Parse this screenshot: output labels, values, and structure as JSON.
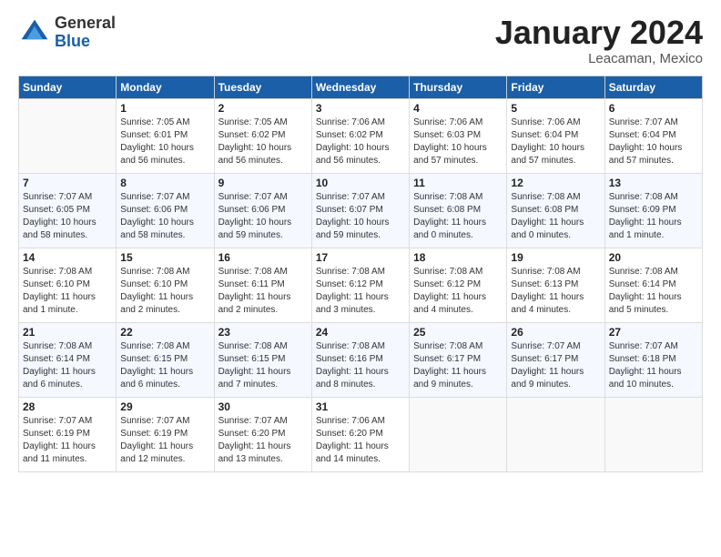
{
  "header": {
    "logo_general": "General",
    "logo_blue": "Blue",
    "month_title": "January 2024",
    "location": "Leacaman, Mexico"
  },
  "weekdays": [
    "Sunday",
    "Monday",
    "Tuesday",
    "Wednesday",
    "Thursday",
    "Friday",
    "Saturday"
  ],
  "weeks": [
    [
      {
        "day": "",
        "info": ""
      },
      {
        "day": "1",
        "info": "Sunrise: 7:05 AM\nSunset: 6:01 PM\nDaylight: 10 hours\nand 56 minutes."
      },
      {
        "day": "2",
        "info": "Sunrise: 7:05 AM\nSunset: 6:02 PM\nDaylight: 10 hours\nand 56 minutes."
      },
      {
        "day": "3",
        "info": "Sunrise: 7:06 AM\nSunset: 6:02 PM\nDaylight: 10 hours\nand 56 minutes."
      },
      {
        "day": "4",
        "info": "Sunrise: 7:06 AM\nSunset: 6:03 PM\nDaylight: 10 hours\nand 57 minutes."
      },
      {
        "day": "5",
        "info": "Sunrise: 7:06 AM\nSunset: 6:04 PM\nDaylight: 10 hours\nand 57 minutes."
      },
      {
        "day": "6",
        "info": "Sunrise: 7:07 AM\nSunset: 6:04 PM\nDaylight: 10 hours\nand 57 minutes."
      }
    ],
    [
      {
        "day": "7",
        "info": "Sunrise: 7:07 AM\nSunset: 6:05 PM\nDaylight: 10 hours\nand 58 minutes."
      },
      {
        "day": "8",
        "info": "Sunrise: 7:07 AM\nSunset: 6:06 PM\nDaylight: 10 hours\nand 58 minutes."
      },
      {
        "day": "9",
        "info": "Sunrise: 7:07 AM\nSunset: 6:06 PM\nDaylight: 10 hours\nand 59 minutes."
      },
      {
        "day": "10",
        "info": "Sunrise: 7:07 AM\nSunset: 6:07 PM\nDaylight: 10 hours\nand 59 minutes."
      },
      {
        "day": "11",
        "info": "Sunrise: 7:08 AM\nSunset: 6:08 PM\nDaylight: 11 hours\nand 0 minutes."
      },
      {
        "day": "12",
        "info": "Sunrise: 7:08 AM\nSunset: 6:08 PM\nDaylight: 11 hours\nand 0 minutes."
      },
      {
        "day": "13",
        "info": "Sunrise: 7:08 AM\nSunset: 6:09 PM\nDaylight: 11 hours\nand 1 minute."
      }
    ],
    [
      {
        "day": "14",
        "info": "Sunrise: 7:08 AM\nSunset: 6:10 PM\nDaylight: 11 hours\nand 1 minute."
      },
      {
        "day": "15",
        "info": "Sunrise: 7:08 AM\nSunset: 6:10 PM\nDaylight: 11 hours\nand 2 minutes."
      },
      {
        "day": "16",
        "info": "Sunrise: 7:08 AM\nSunset: 6:11 PM\nDaylight: 11 hours\nand 2 minutes."
      },
      {
        "day": "17",
        "info": "Sunrise: 7:08 AM\nSunset: 6:12 PM\nDaylight: 11 hours\nand 3 minutes."
      },
      {
        "day": "18",
        "info": "Sunrise: 7:08 AM\nSunset: 6:12 PM\nDaylight: 11 hours\nand 4 minutes."
      },
      {
        "day": "19",
        "info": "Sunrise: 7:08 AM\nSunset: 6:13 PM\nDaylight: 11 hours\nand 4 minutes."
      },
      {
        "day": "20",
        "info": "Sunrise: 7:08 AM\nSunset: 6:14 PM\nDaylight: 11 hours\nand 5 minutes."
      }
    ],
    [
      {
        "day": "21",
        "info": "Sunrise: 7:08 AM\nSunset: 6:14 PM\nDaylight: 11 hours\nand 6 minutes."
      },
      {
        "day": "22",
        "info": "Sunrise: 7:08 AM\nSunset: 6:15 PM\nDaylight: 11 hours\nand 6 minutes."
      },
      {
        "day": "23",
        "info": "Sunrise: 7:08 AM\nSunset: 6:15 PM\nDaylight: 11 hours\nand 7 minutes."
      },
      {
        "day": "24",
        "info": "Sunrise: 7:08 AM\nSunset: 6:16 PM\nDaylight: 11 hours\nand 8 minutes."
      },
      {
        "day": "25",
        "info": "Sunrise: 7:08 AM\nSunset: 6:17 PM\nDaylight: 11 hours\nand 9 minutes."
      },
      {
        "day": "26",
        "info": "Sunrise: 7:07 AM\nSunset: 6:17 PM\nDaylight: 11 hours\nand 9 minutes."
      },
      {
        "day": "27",
        "info": "Sunrise: 7:07 AM\nSunset: 6:18 PM\nDaylight: 11 hours\nand 10 minutes."
      }
    ],
    [
      {
        "day": "28",
        "info": "Sunrise: 7:07 AM\nSunset: 6:19 PM\nDaylight: 11 hours\nand 11 minutes."
      },
      {
        "day": "29",
        "info": "Sunrise: 7:07 AM\nSunset: 6:19 PM\nDaylight: 11 hours\nand 12 minutes."
      },
      {
        "day": "30",
        "info": "Sunrise: 7:07 AM\nSunset: 6:20 PM\nDaylight: 11 hours\nand 13 minutes."
      },
      {
        "day": "31",
        "info": "Sunrise: 7:06 AM\nSunset: 6:20 PM\nDaylight: 11 hours\nand 14 minutes."
      },
      {
        "day": "",
        "info": ""
      },
      {
        "day": "",
        "info": ""
      },
      {
        "day": "",
        "info": ""
      }
    ]
  ]
}
